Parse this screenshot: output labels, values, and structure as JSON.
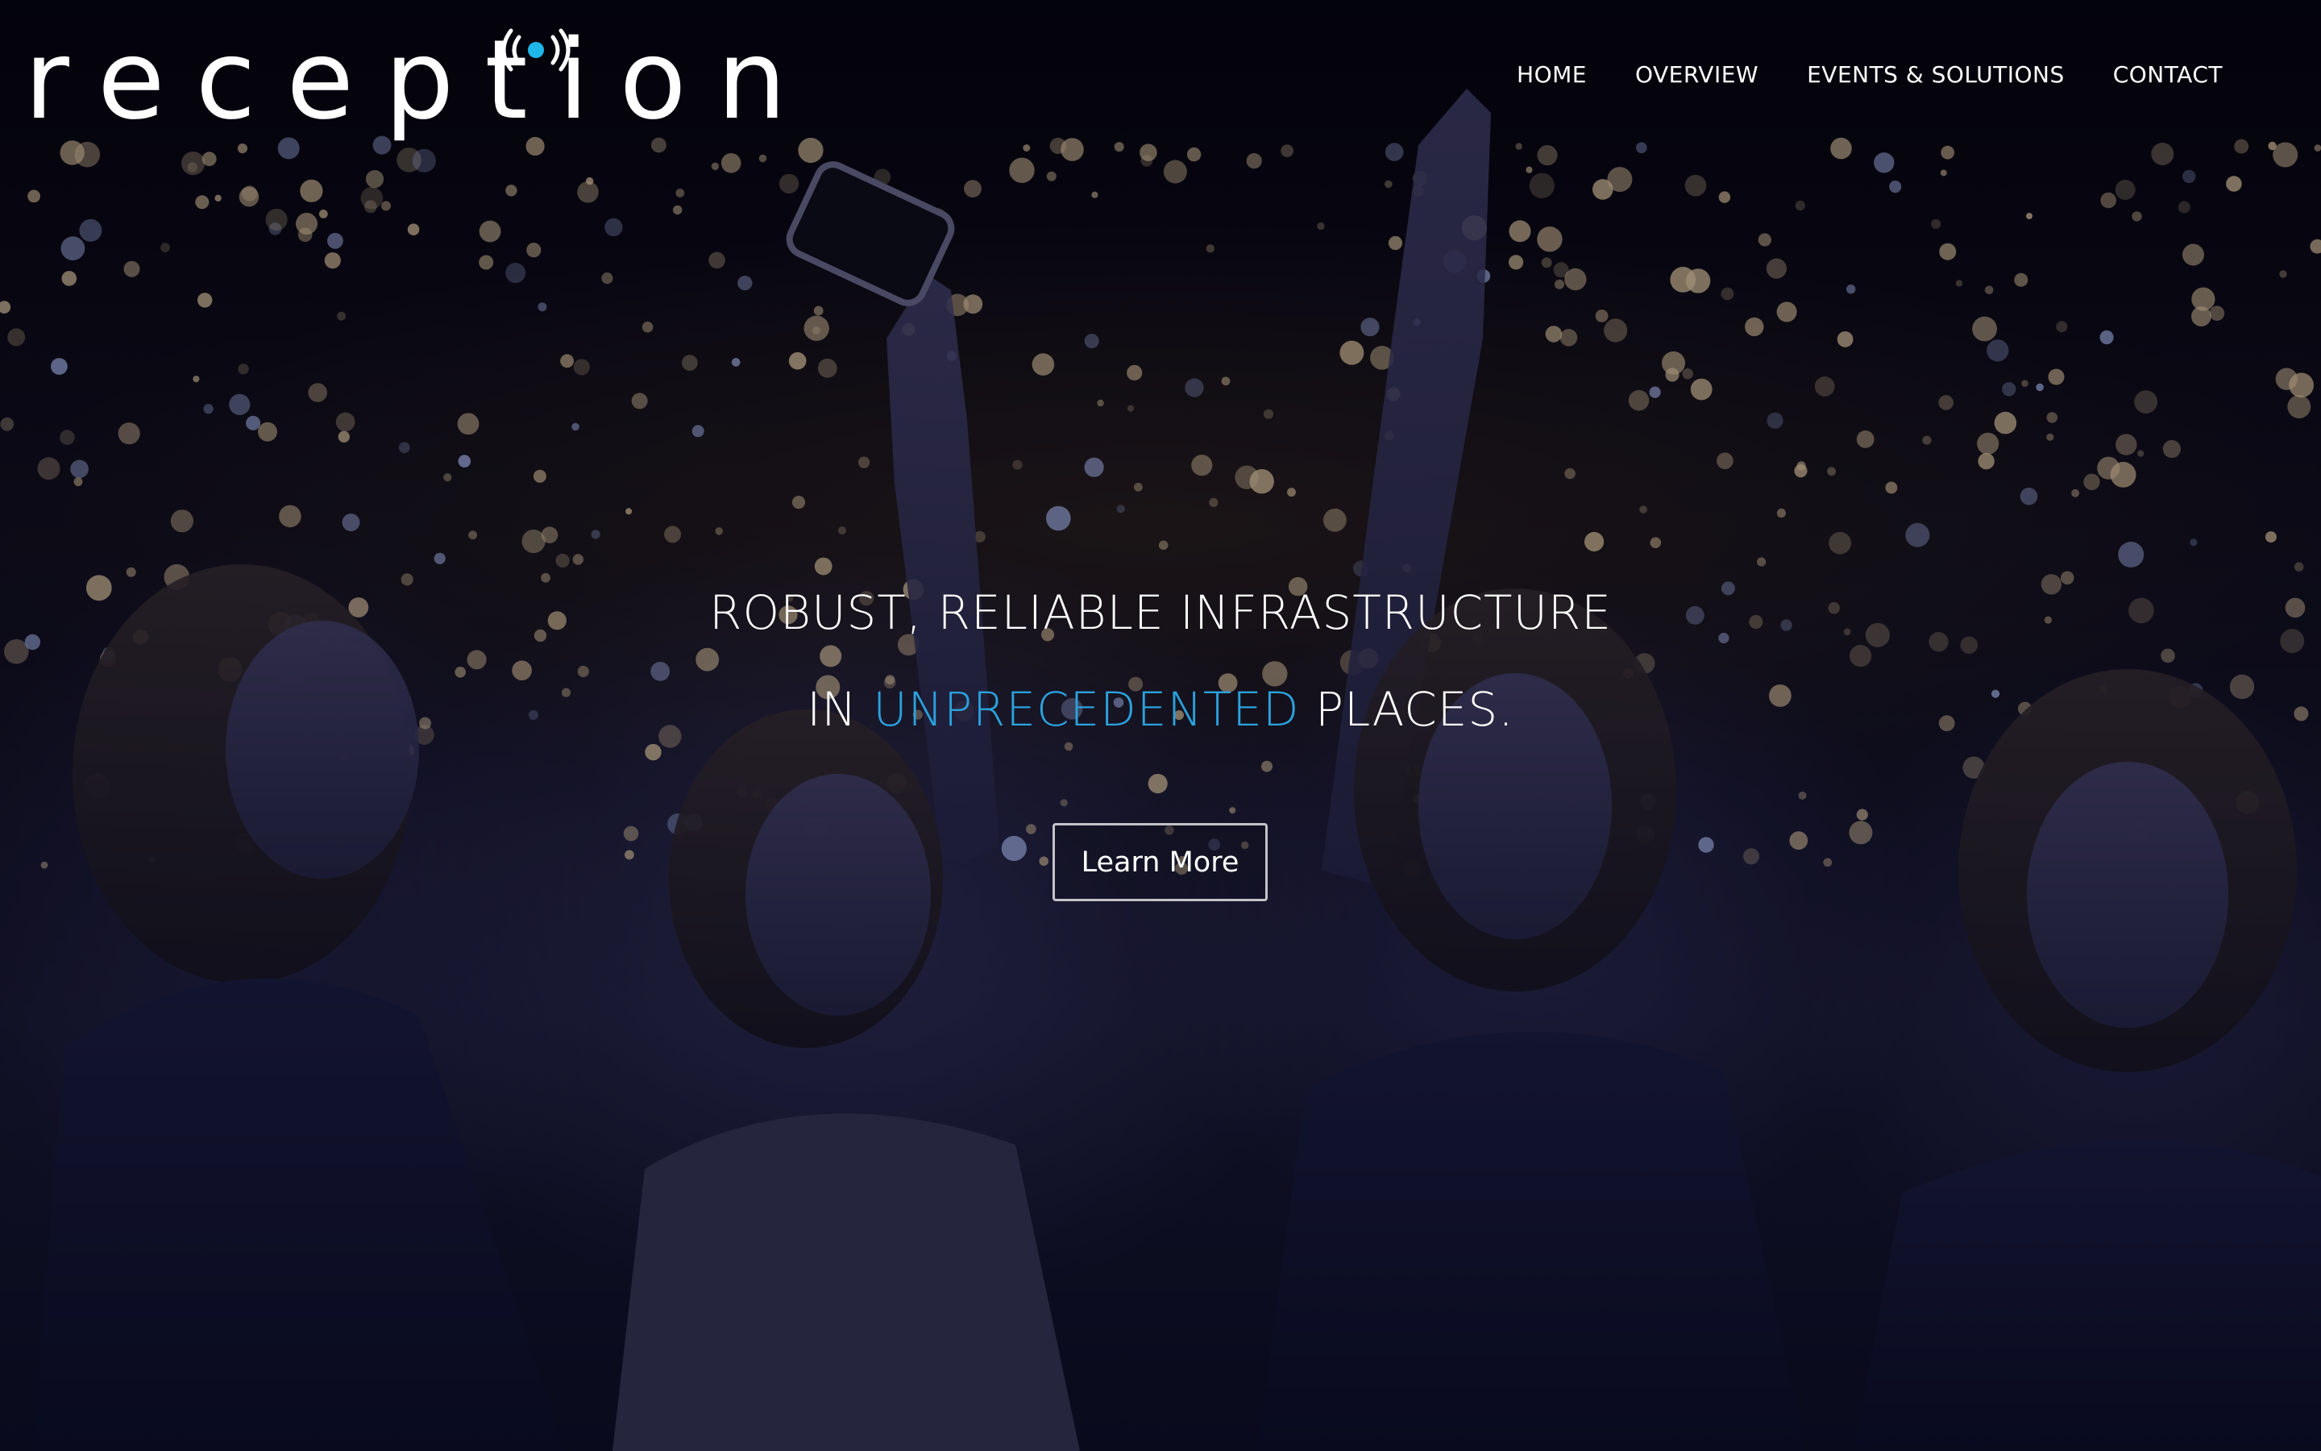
{
  "header": {
    "logo": {
      "text": "reception",
      "accent_color": "#1fb6e8"
    },
    "nav": [
      {
        "label": "HOME"
      },
      {
        "label": "OVERVIEW"
      },
      {
        "label": "EVENTS & SOLUTIONS"
      },
      {
        "label": "CONTACT"
      }
    ]
  },
  "hero": {
    "background": "concert-crowd-photo",
    "headline": {
      "line1": "ROBUST, RELIABLE INFRASTRUCTURE",
      "line2_prefix": "IN ",
      "line2_accent": "UNPRECEDENTED",
      "line2_suffix": " PLACES."
    },
    "cta_label": "Learn More",
    "accent_color": "#2aa2de"
  }
}
